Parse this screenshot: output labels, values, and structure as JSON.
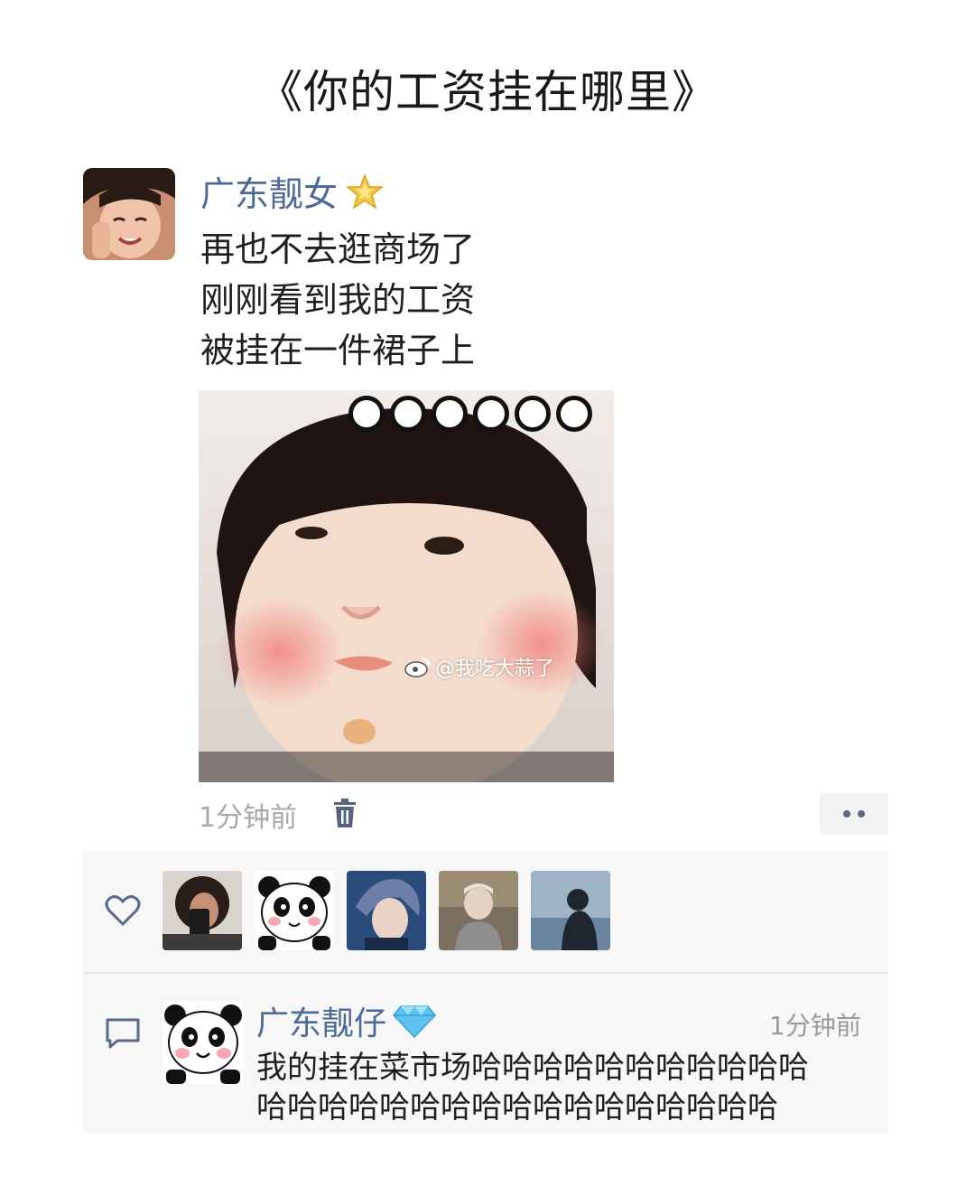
{
  "page": {
    "title": "《你的工资挂在哪里》"
  },
  "post": {
    "author": "广东靓女",
    "author_badge": "star-badge-icon",
    "lines": [
      "再也不去逛商场了",
      "刚刚看到我的工资",
      "被挂在一件裙子上"
    ],
    "image_watermark": "@我吃大蒜了",
    "time": "1分钟前"
  },
  "likes": {
    "icon": "heart-icon",
    "likers": [
      "avatar-1",
      "panda-avatar",
      "anime-avatar",
      "avatar-4",
      "avatar-5"
    ]
  },
  "comment": {
    "icon": "comment-icon",
    "author": "广东靓仔",
    "author_badge": "diamond-badge-icon",
    "time": "1分钟前",
    "lines": [
      "我的挂在菜市场哈哈哈哈哈哈哈哈哈哈哈",
      "哈哈哈哈哈哈哈哈哈哈哈哈哈哈哈哈哈"
    ]
  },
  "colors": {
    "username": "#4d6a96",
    "panel": "#f7f7f7",
    "time": "#a7a7a7"
  }
}
